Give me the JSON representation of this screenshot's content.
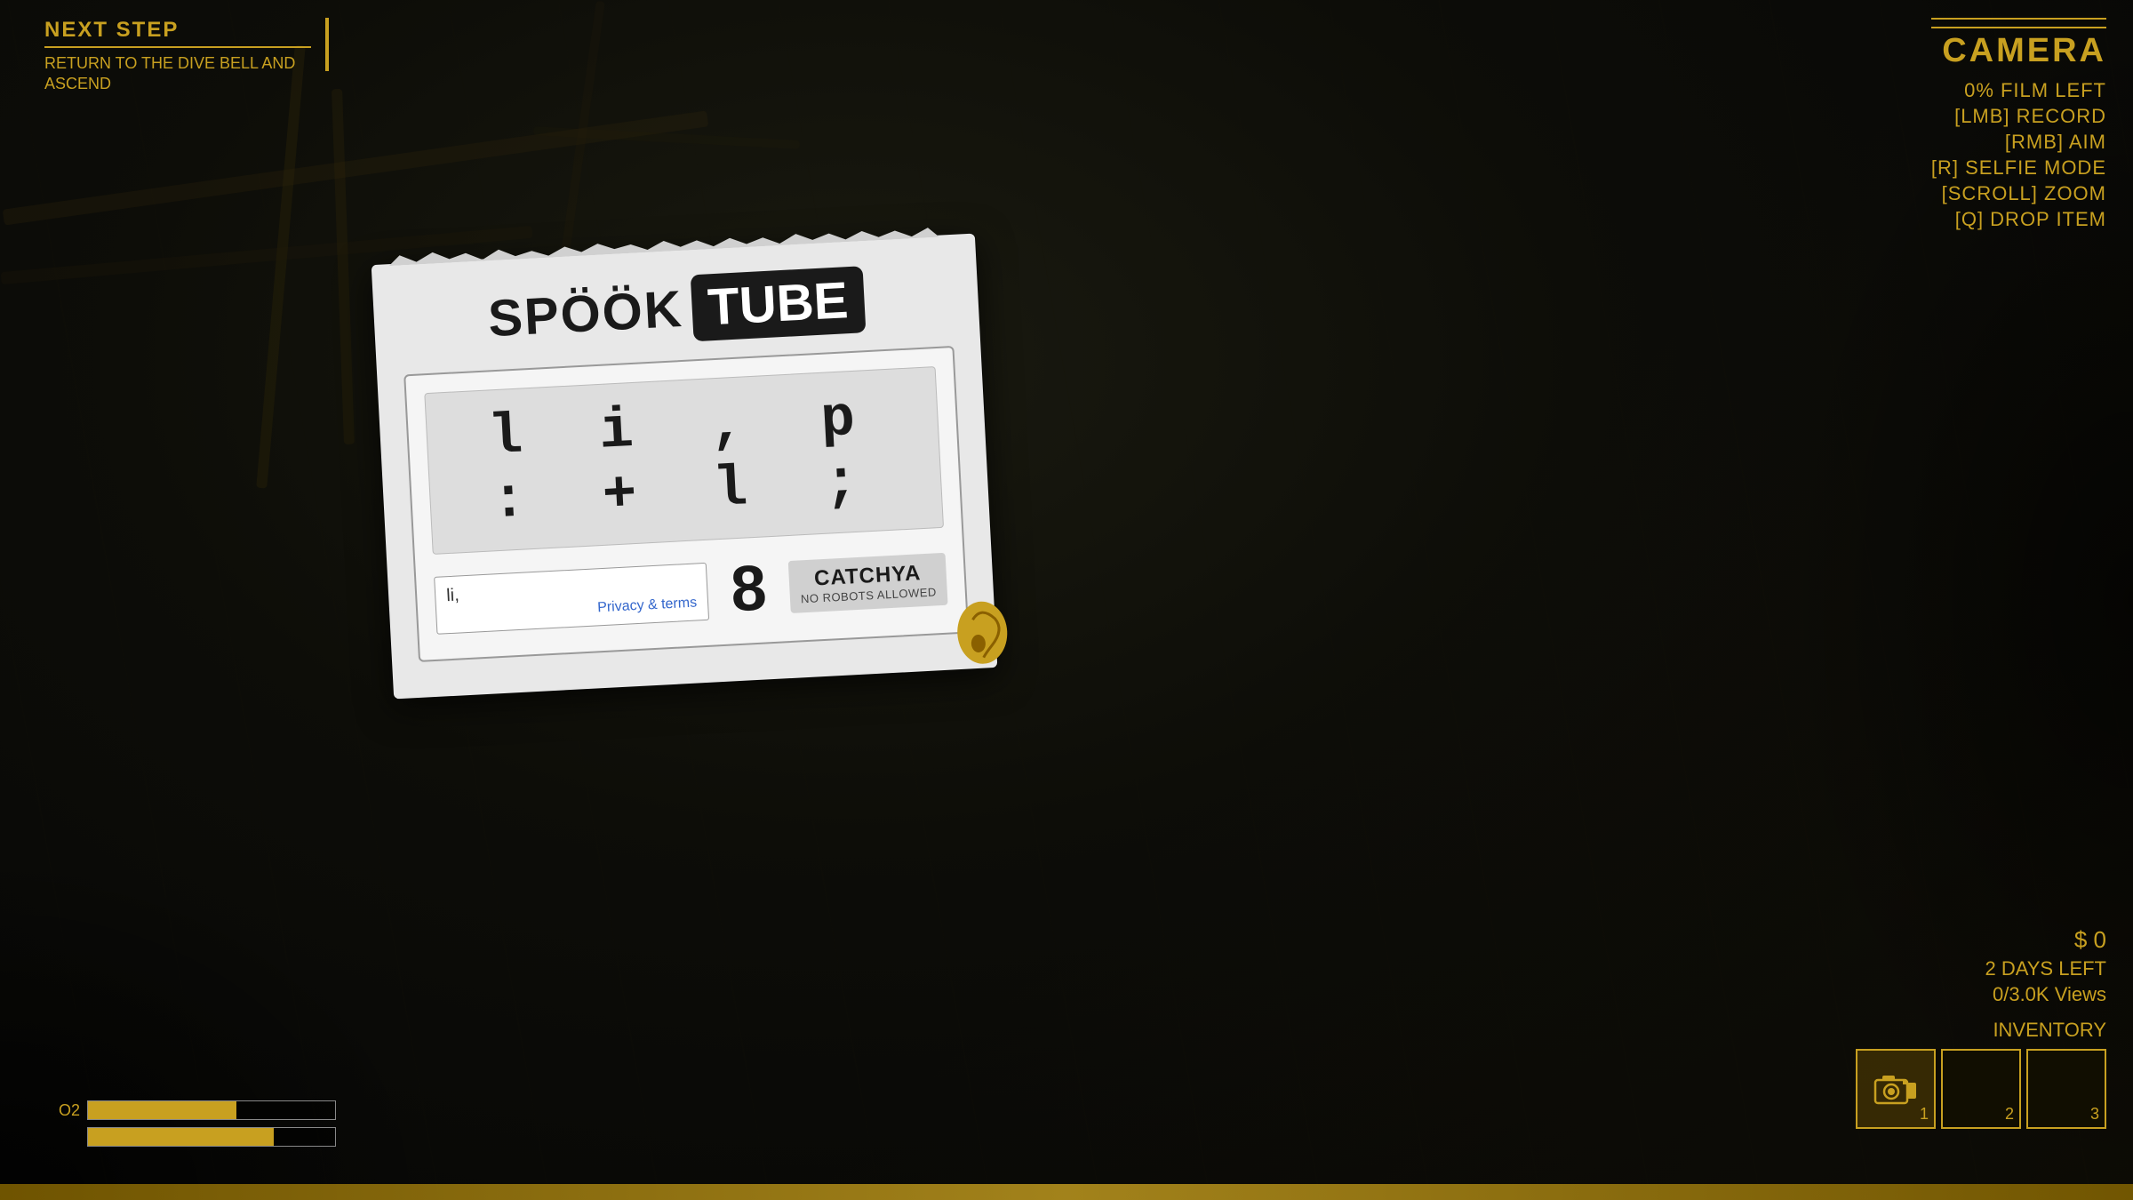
{
  "background": {
    "color": "#050505"
  },
  "top_left": {
    "next_step_label": "NEXT STEP",
    "next_step_desc": "RETURN TO THE DIVE BELL AND ASCEND"
  },
  "top_right": {
    "camera_title": "CAMERA",
    "film_left": "0% FILM LEFT",
    "lmb_record": "[LMB] RECORD",
    "rmb_aim": "[RMB] AIM",
    "r_selfie": "[R] SELFIE MODE",
    "scroll_zoom": "[SCROLL] ZOOM",
    "q_drop": "[Q] DROP ITEM"
  },
  "bottom_right": {
    "money": "$ 0",
    "days_left": "2 DAYS LEFT",
    "views": "0/3.0K Views",
    "inventory_label": "INVENTORY",
    "slots": [
      {
        "number": "1",
        "has_item": true,
        "item_type": "camera"
      },
      {
        "number": "2",
        "has_item": false,
        "item_type": ""
      },
      {
        "number": "3",
        "has_item": false,
        "item_type": ""
      }
    ]
  },
  "bottom_left": {
    "o2_label": "O2",
    "health_label": ""
  },
  "captcha_card": {
    "brand_text": "SPÖÖK",
    "brand_badge": "TUBE",
    "captcha_chars": "l i , p : + l ;",
    "captcha_input_value": "li,",
    "privacy_link": "Privacy & terms",
    "captcha_number": "8",
    "catchya_title": "CATCHYA",
    "catchya_subtitle": "NO ROBOTS ALLOWED"
  }
}
